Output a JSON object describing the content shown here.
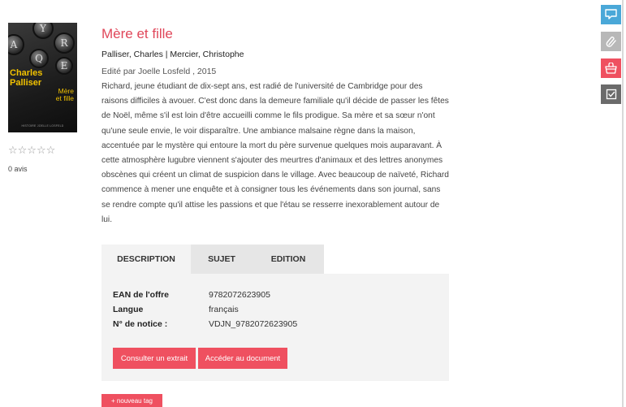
{
  "book": {
    "title": "Mère et fille",
    "authors": "Palliser, Charles | Mercier, Christophe",
    "edition": "Edité par Joelle Losfeld , 2015",
    "description": "Richard, jeune étudiant de dix-sept ans, est radié de l'université de Cambridge pour des raisons difficiles à avouer. C'est donc dans la demeure familiale qu'il décide de passer les fêtes de Noël, même s'il est loin d'être accueilli comme le fils prodigue. Sa mère et sa sœur n'ont qu'une seule envie, le voir disparaître. Une ambiance malsaine règne dans la maison, accentuée par le mystère qui entoure la mort du père survenue quelques mois auparavant. À cette atmosphère lugubre viennent s'ajouter des meurtres d'animaux et des lettres anonymes obscènes qui créent un climat de suspicion dans le village. Avec beaucoup de naïveté, Richard commence à mener une enquête et à consigner tous les événements dans son journal, sans se rendre compte qu'il attise les passions et que l'étau se resserre inexorablement autour de lui."
  },
  "cover": {
    "author_line1": "Charles",
    "author_line2": "Palliser",
    "title_line1": "Mère",
    "title_line2": "et fille",
    "footer": "HISTOIRE JOELLE LOSFELD",
    "keys": [
      "Y",
      "A",
      "R",
      "Q",
      "E"
    ]
  },
  "rating": {
    "stars": "☆☆☆☆☆",
    "star_count": 5,
    "score": 0,
    "reviews": "0 avis"
  },
  "tabs": [
    "DESCRIPTION",
    "SUJET",
    "EDITION"
  ],
  "active_tab": "DESCRIPTION",
  "details": [
    {
      "label": "EAN de l'offre",
      "value": "9782072623905"
    },
    {
      "label": "Langue",
      "value": "français"
    },
    {
      "label": "N° de notice :",
      "value": "VDJN_9782072623905"
    }
  ],
  "buttons": {
    "extract": "Consulter un extrait",
    "access": "Accéder au document",
    "new_tag": "+ nouveau tag"
  },
  "sidebar": [
    {
      "icon": "speech-bubble-icon",
      "color": "#4aa8d8"
    },
    {
      "icon": "paperclip-icon",
      "color": "#b8b8b8"
    },
    {
      "icon": "basket-icon",
      "color": "#ef5060"
    },
    {
      "icon": "checklist-icon",
      "color": "#6b6b6b"
    }
  ],
  "colors": {
    "accent": "#ef5060",
    "title": "#e0475a",
    "tab_active": "#f3f3f3",
    "tab_inactive": "#e6e6e6"
  }
}
